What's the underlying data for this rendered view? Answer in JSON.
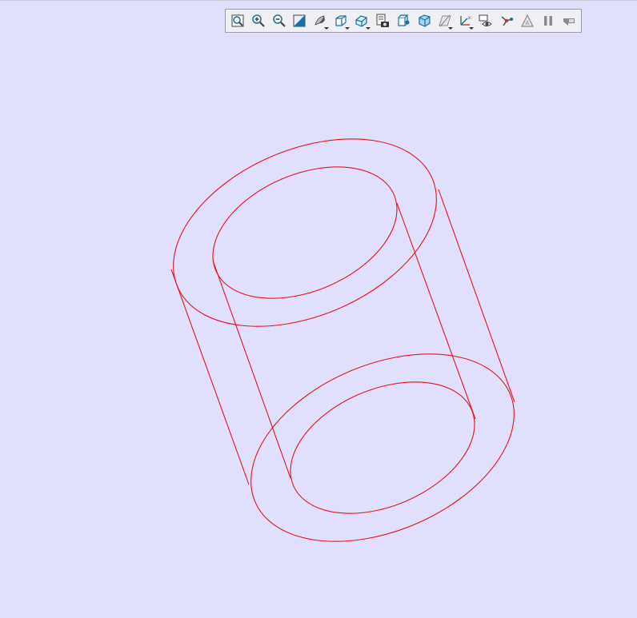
{
  "viewer": {
    "background": "#e0e0fc",
    "wire_color": "#e8101a"
  },
  "toolbar": {
    "buttons": [
      {
        "name": "fit-all-button",
        "icon": "fit-all-icon",
        "dropdown": false
      },
      {
        "name": "zoom-in-button",
        "icon": "zoom-in-icon",
        "dropdown": false
      },
      {
        "name": "zoom-out-button",
        "icon": "zoom-out-icon",
        "dropdown": false
      },
      {
        "name": "background-color-button",
        "icon": "background-color-icon",
        "dropdown": false
      },
      {
        "name": "display-mode-button",
        "icon": "shading-icon",
        "dropdown": true
      },
      {
        "name": "view-orientation-button",
        "icon": "cube-view-icon",
        "dropdown": true
      },
      {
        "name": "projection-button",
        "icon": "projection-icon",
        "dropdown": true
      },
      {
        "name": "snapshot-button",
        "icon": "camera-icon",
        "dropdown": false
      },
      {
        "name": "section-button",
        "icon": "section-icon",
        "dropdown": false
      },
      {
        "name": "transparency-button",
        "icon": "transparency-icon",
        "dropdown": false
      },
      {
        "name": "clipping-plane-button",
        "icon": "clipping-plane-icon",
        "dropdown": true
      },
      {
        "name": "axis-triedron-button",
        "icon": "axes-icon",
        "dropdown": true
      },
      {
        "name": "view-properties-button",
        "icon": "eye-settings-icon",
        "dropdown": false
      },
      {
        "name": "explode-button",
        "icon": "nodes-icon",
        "dropdown": false
      },
      {
        "name": "measure-button",
        "icon": "measure-icon",
        "dropdown": false
      },
      {
        "name": "pause-button",
        "icon": "pause-icon",
        "dropdown": false
      },
      {
        "name": "sync-button",
        "icon": "sync-icon",
        "dropdown": false
      }
    ]
  }
}
